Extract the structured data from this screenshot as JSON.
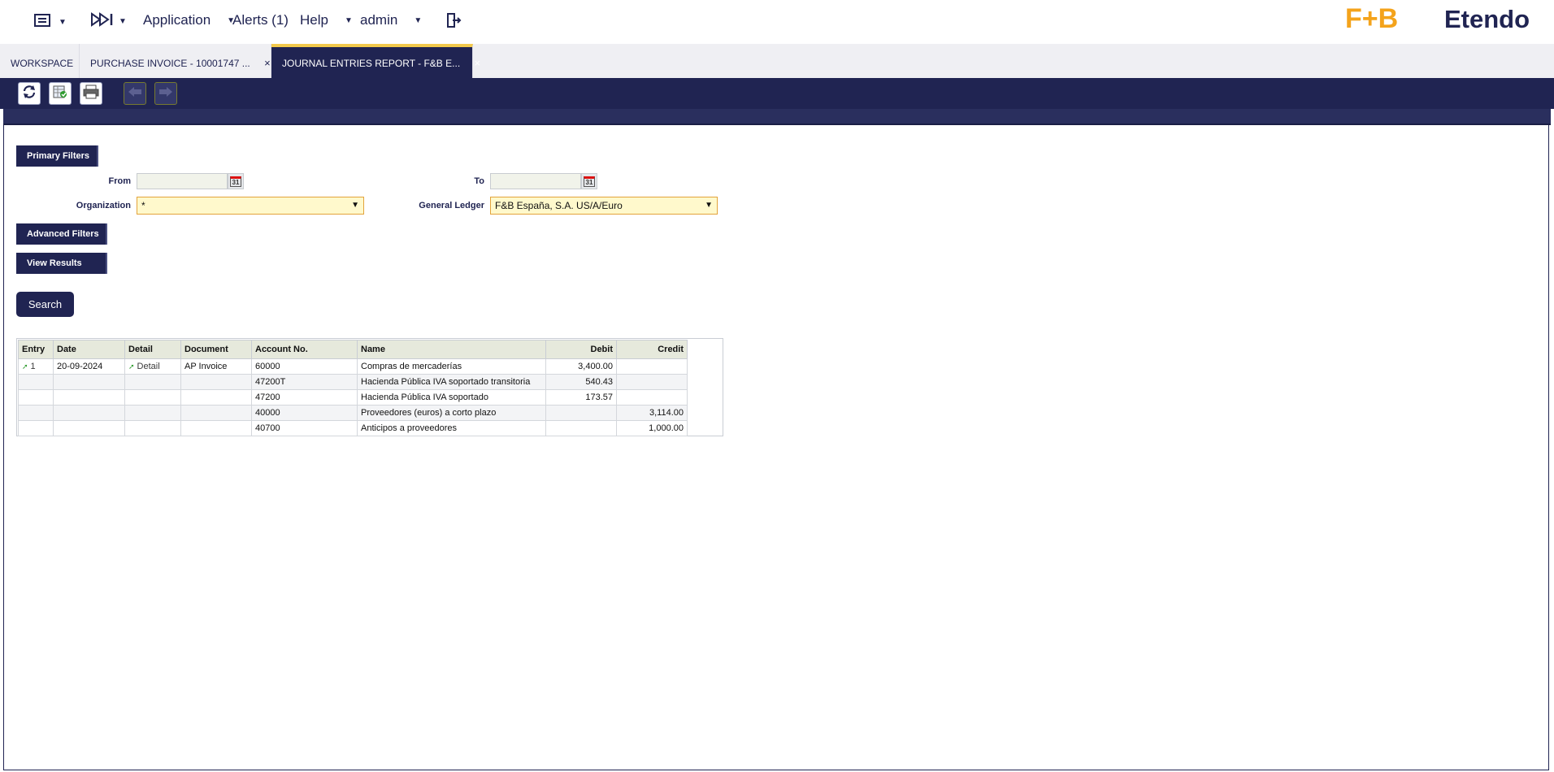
{
  "nav": {
    "application": "Application",
    "alerts": "Alerts (1)",
    "help": "Help",
    "user": "admin"
  },
  "brand": {
    "fb": "F+B",
    "etendo": "Etendo"
  },
  "tabs": [
    {
      "label": "WORKSPACE"
    },
    {
      "label": "PURCHASE INVOICE - 10001747 ...",
      "close": "×"
    },
    {
      "label": "JOURNAL ENTRIES REPORT - F&B E...",
      "close": "×"
    }
  ],
  "filters": {
    "primary_label": "Primary Filters",
    "from_label": "From",
    "to_label": "To",
    "calendar_glyph": "31",
    "organization_label": "Organization",
    "organization_value": "*",
    "ledger_label": "General Ledger",
    "ledger_value": "F&B España, S.A. US/A/Euro",
    "advanced_label": "Advanced Filters",
    "view_results_label": "View Results",
    "search_label": "Search"
  },
  "table": {
    "headers": {
      "entry": "Entry",
      "date": "Date",
      "detail": "Detail",
      "document": "Document",
      "account": "Account No.",
      "name": "Name",
      "debit": "Debit",
      "credit": "Credit"
    },
    "rows": [
      {
        "entry": "1",
        "date": "20-09-2024",
        "detail": "Detail",
        "document": "AP Invoice",
        "account": "60000",
        "name": "Compras de mercaderías",
        "debit": "3,400.00",
        "credit": ""
      },
      {
        "entry": "",
        "date": "",
        "detail": "",
        "document": "",
        "account": "47200T",
        "name": "Hacienda Pública IVA soportado transitoria",
        "debit": "540.43",
        "credit": ""
      },
      {
        "entry": "",
        "date": "",
        "detail": "",
        "document": "",
        "account": "47200",
        "name": "Hacienda Pública IVA soportado",
        "debit": "173.57",
        "credit": ""
      },
      {
        "entry": "",
        "date": "",
        "detail": "",
        "document": "",
        "account": "40000",
        "name": "Proveedores (euros) a corto plazo",
        "debit": "",
        "credit": "3,114.00"
      },
      {
        "entry": "",
        "date": "",
        "detail": "",
        "document": "",
        "account": "40700",
        "name": "Anticipos a proveedores",
        "debit": "",
        "credit": "1,000.00"
      }
    ]
  }
}
